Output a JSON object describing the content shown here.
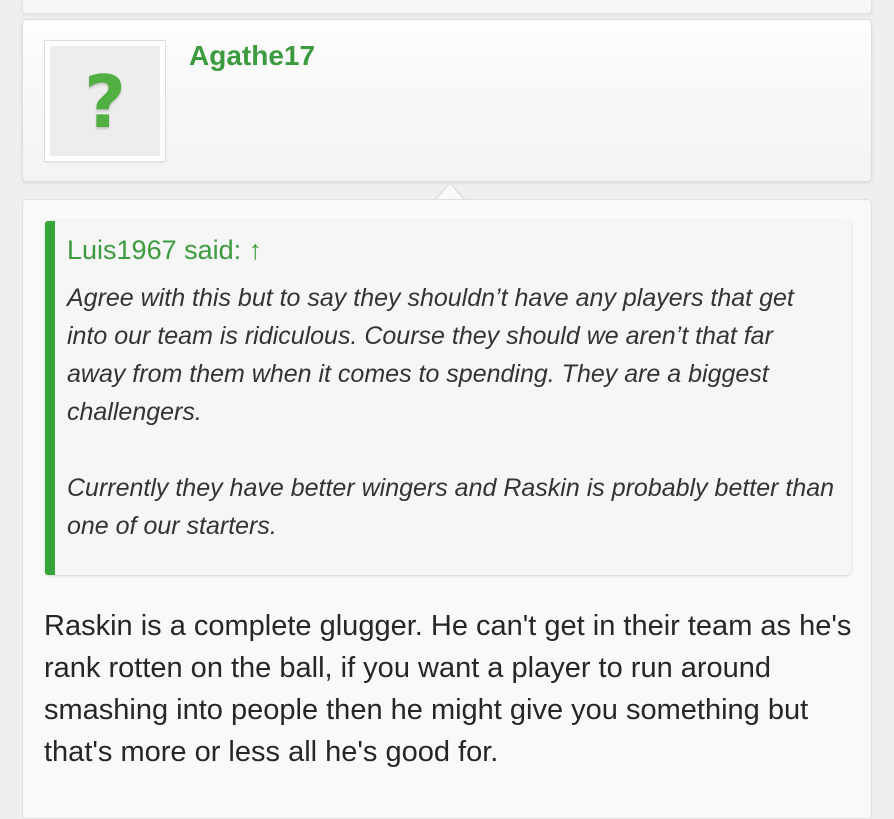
{
  "post": {
    "username": "Agathe17",
    "avatar_icon": "question-mark-icon",
    "avatar_glyph": "?",
    "quote": {
      "attribution": "Luis1967 said: ↑",
      "paragraphs": [
        "Agree with this but to say they shouldn’t have any players that get into our team is ridiculous. Course they should we aren’t that far away from them when it comes to spending. They are a biggest challengers.",
        "Currently they have better wingers and Raskin is probably better than one of our starters."
      ]
    },
    "body": "Raskin is a complete glugger. He can't get in their team as he's rank rotten on the ball, if you want a player to run around smashing into people then he might give you something but that's more or less all he's good for."
  },
  "colors": {
    "accent": "#3c9b3e",
    "quote_bar": "#36a63a",
    "avatar_glyph": "#52b043"
  }
}
